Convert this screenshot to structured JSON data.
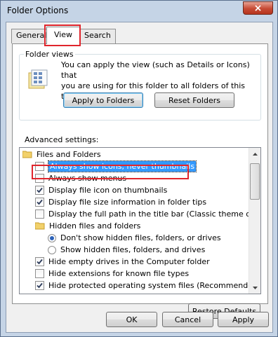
{
  "window": {
    "title": "Folder Options",
    "close_glyph": "×"
  },
  "tabs": [
    {
      "label": "General",
      "active": false
    },
    {
      "label": "View",
      "active": true
    },
    {
      "label": "Search",
      "active": false
    }
  ],
  "folder_views": {
    "label": "Folder views",
    "description_line1": "You can apply the view (such as Details or Icons) that",
    "description_line2": "you are using for this folder to all folders of this type.",
    "apply_button": "Apply to Folders",
    "reset_button": "Reset Folders"
  },
  "advanced": {
    "label": "Advanced settings:",
    "items": [
      {
        "type": "folder",
        "label": "Files and Folders"
      },
      {
        "type": "checkbox",
        "label": "Always show icons, never thumbnails",
        "checked": false,
        "selected": true
      },
      {
        "type": "checkbox",
        "label": "Always show menus",
        "checked": false
      },
      {
        "type": "checkbox",
        "label": "Display file icon on thumbnails",
        "checked": true
      },
      {
        "type": "checkbox",
        "label": "Display file size information in folder tips",
        "checked": true
      },
      {
        "type": "checkbox",
        "label": "Display the full path in the title bar (Classic theme only)",
        "checked": false
      },
      {
        "type": "folder",
        "label": "Hidden files and folders"
      },
      {
        "type": "radio",
        "label": "Don't show hidden files, folders, or drives",
        "checked": true
      },
      {
        "type": "radio",
        "label": "Show hidden files, folders, and drives",
        "checked": false
      },
      {
        "type": "checkbox",
        "label": "Hide empty drives in the Computer folder",
        "checked": true
      },
      {
        "type": "checkbox",
        "label": "Hide extensions for known file types",
        "checked": false
      },
      {
        "type": "checkbox",
        "label": "Hide protected operating system files (Recommended)",
        "checked": true
      }
    ]
  },
  "restore_defaults_button": "Restore Defaults",
  "footer": {
    "ok": "OK",
    "cancel": "Cancel",
    "apply": "Apply"
  },
  "colors": {
    "accent_highlight": "#e0252c",
    "selection": "#3399ff"
  }
}
